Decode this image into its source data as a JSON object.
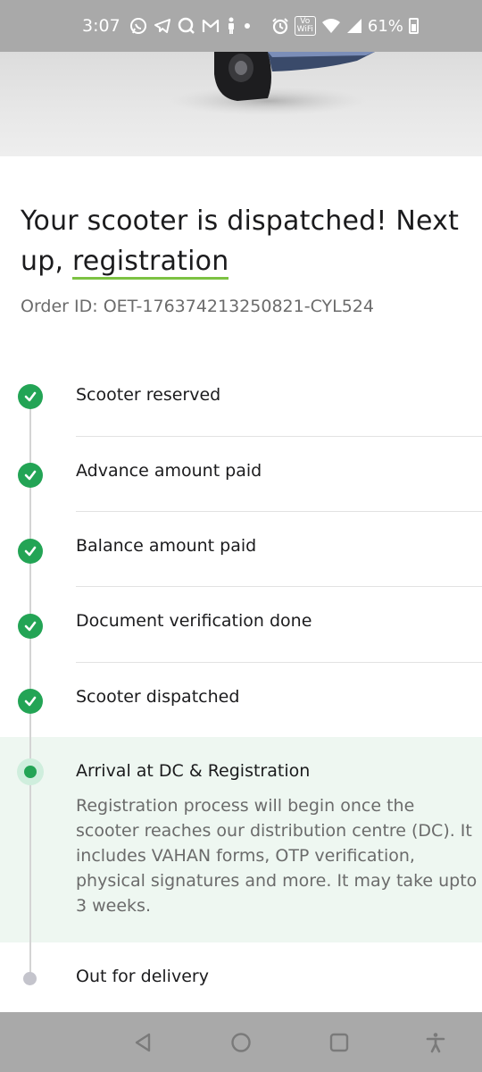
{
  "status_bar": {
    "time": "3:07",
    "battery": "61%",
    "icons": [
      "whatsapp-icon",
      "telegram-icon",
      "search-icon",
      "gmail-icon",
      "person-icon",
      "dot-icon",
      "alarm-icon",
      "vowifi-icon",
      "wifi-icon",
      "signal-icon",
      "battery-icon"
    ],
    "vowifi_text_top": "Vo",
    "vowifi_text_bottom": "WiFi"
  },
  "header": {
    "title_part1": "Your scooter is dispatched! Next up, ",
    "title_highlight": "registration",
    "order_id": "Order ID: OET-176374213250821-CYL524"
  },
  "timeline": {
    "steps": [
      {
        "label": "Scooter reserved",
        "status": "done"
      },
      {
        "label": "Advance amount paid",
        "status": "done"
      },
      {
        "label": "Balance amount paid",
        "status": "done"
      },
      {
        "label": "Document verification done",
        "status": "done"
      },
      {
        "label": "Scooter dispatched",
        "status": "done"
      },
      {
        "label": "Arrival at DC & Registration",
        "status": "active"
      },
      {
        "label": "Out for delivery",
        "status": "pending"
      }
    ],
    "active_description": "Registration process will begin once the scooter reaches our distribution centre (DC). It includes VAHAN forms, OTP verification, physical signatures and more. It may take upto 3 weeks."
  },
  "nav_bar": {
    "icons": [
      "back-icon",
      "home-icon",
      "recents-icon",
      "accessibility-icon"
    ]
  },
  "colors": {
    "accent_green": "#23a455",
    "underline_green": "#7cc242",
    "active_bg": "#eef7f1",
    "system_bar": "#a9a9a9"
  }
}
